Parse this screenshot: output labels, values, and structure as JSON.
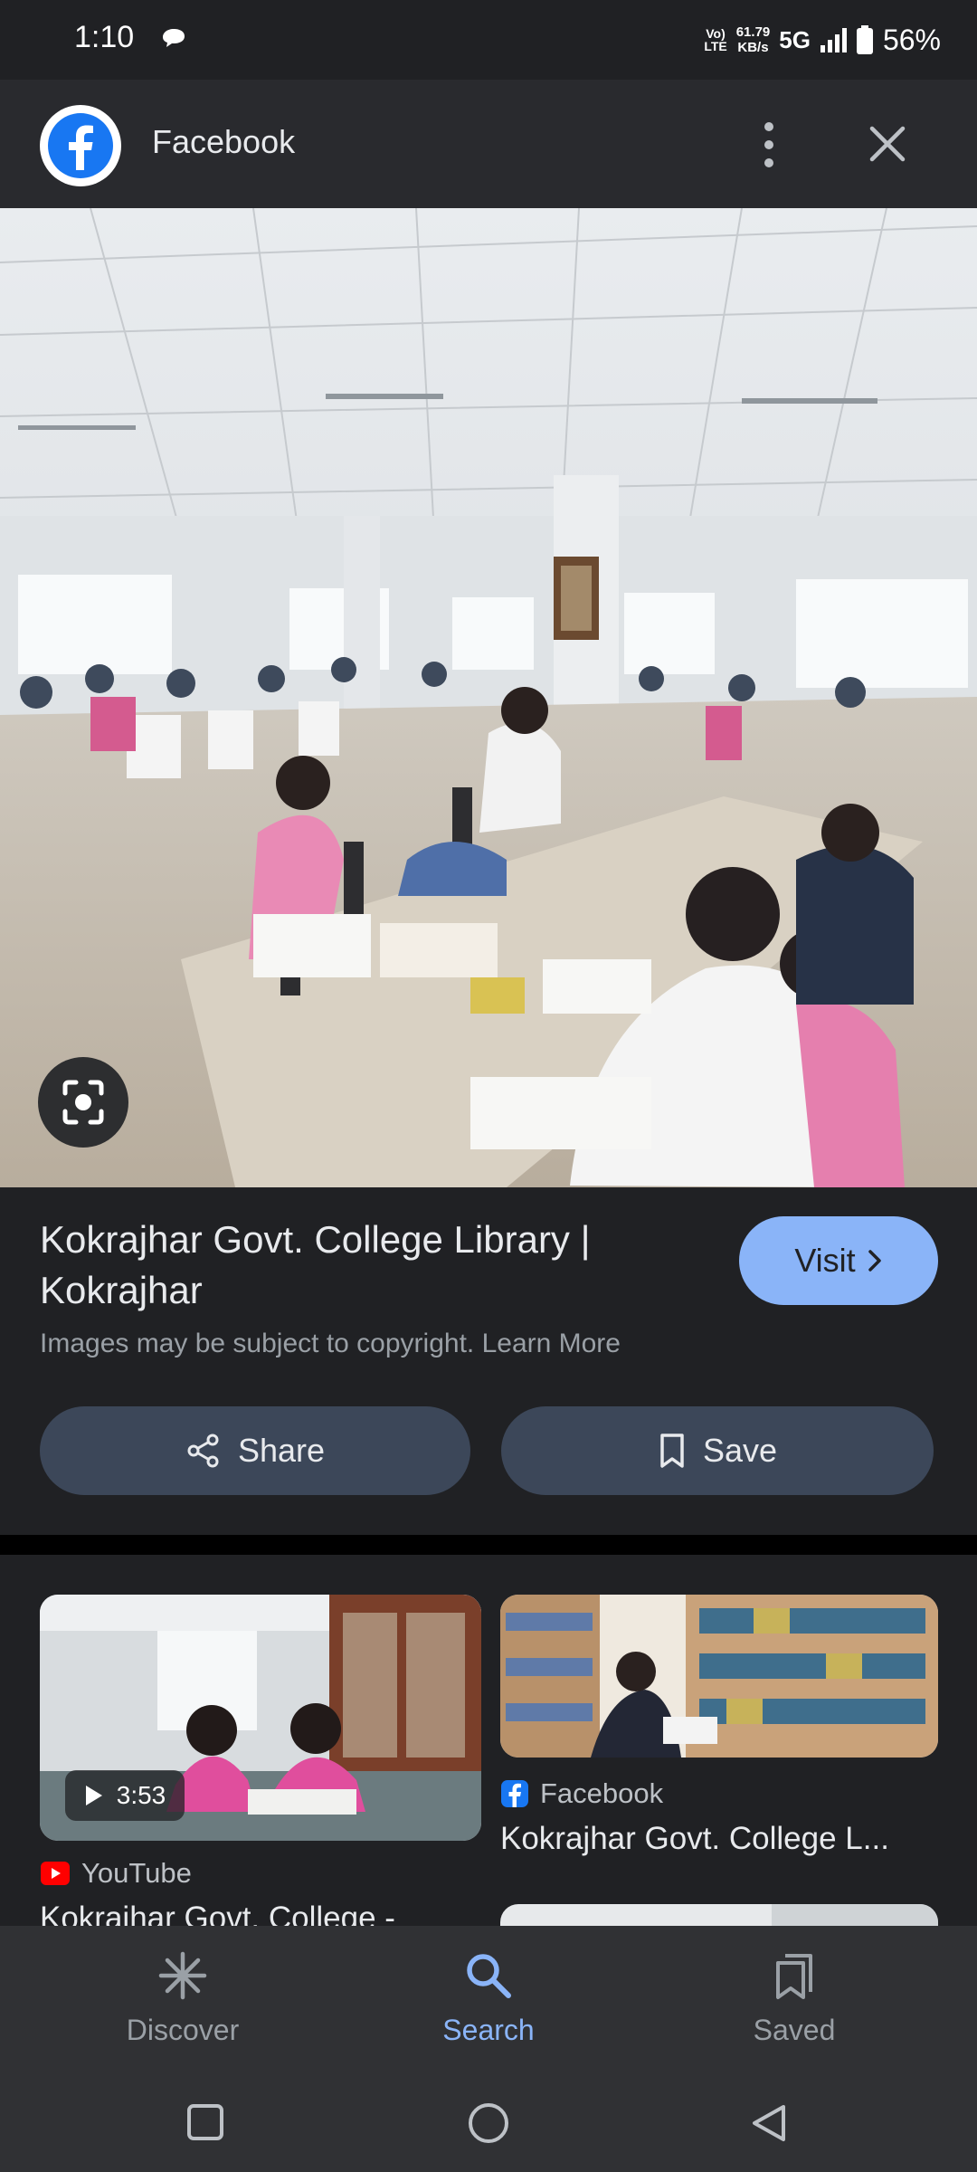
{
  "status_bar": {
    "time": "1:10",
    "volte_top": "Vo)",
    "volte_bottom": "LTE",
    "speed_value": "61.79",
    "speed_unit": "KB/s",
    "network": "5G",
    "battery": "56%"
  },
  "header": {
    "title": "Facebook"
  },
  "result": {
    "title": "Kokrajhar Govt. College Library | Kokrajhar",
    "visit_label": "Visit",
    "copyright_text": "Images may be subject to copyright. Learn More",
    "share_label": "Share",
    "save_label": "Save"
  },
  "related": [
    {
      "source": "YouTube",
      "duration": "3:53",
      "title": "Kokrajhar Govt. College -"
    },
    {
      "source": "Facebook",
      "title": "Kokrajhar Govt. College L..."
    }
  ],
  "bottom_nav": [
    {
      "label": "Discover",
      "icon": "asterisk-icon"
    },
    {
      "label": "Search",
      "icon": "search-icon"
    },
    {
      "label": "Saved",
      "icon": "bookmarks-icon"
    }
  ],
  "system_nav": [
    "recents-square-icon",
    "home-circle-icon",
    "back-triangle-icon"
  ],
  "colors": {
    "background": "#202124",
    "accent": "#8ab4f8",
    "pill": "#3c4759",
    "facebook_blue": "#1877f2",
    "youtube_red": "#ff0000"
  }
}
